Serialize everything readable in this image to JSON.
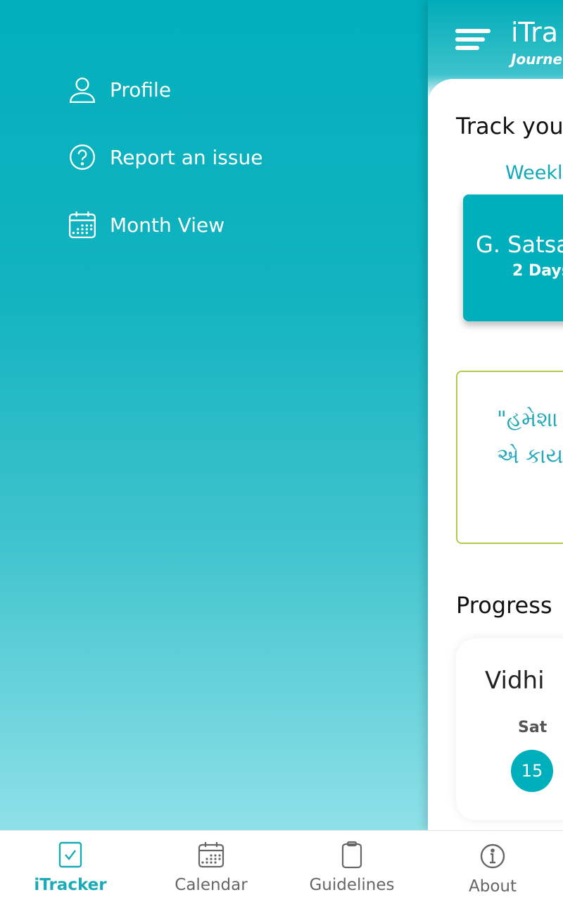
{
  "drawer": {
    "items": [
      {
        "label": "Profile",
        "icon": "user-icon"
      },
      {
        "label": "Report an issue",
        "icon": "question-circle-icon"
      },
      {
        "label": "Month View",
        "icon": "calendar-icon"
      }
    ]
  },
  "header": {
    "title": "iTra",
    "subtitle": "Journe"
  },
  "main": {
    "track_heading": "Track you",
    "weekly_label": "Weekl",
    "tile": {
      "name": "G. Satsa",
      "days": "2 Days"
    },
    "quote": {
      "line1": "\"હમેશા",
      "line2": "એ કાય"
    },
    "progress_heading": "Progress",
    "progress_card": {
      "title": "Vidhi",
      "day_name": "Sat",
      "day_number": "15"
    }
  },
  "bottom_nav": {
    "tabs": [
      {
        "label": "iTracker",
        "icon": "checkbox-icon",
        "active": true
      },
      {
        "label": "Calendar",
        "icon": "calendar-icon"
      },
      {
        "label": "Guidelines",
        "icon": "clipboard-icon"
      },
      {
        "label": "About",
        "icon": "info-icon"
      }
    ]
  },
  "colors": {
    "primary": "#00afbc",
    "quote_border": "#b5c94a",
    "inactive": "#666666"
  }
}
